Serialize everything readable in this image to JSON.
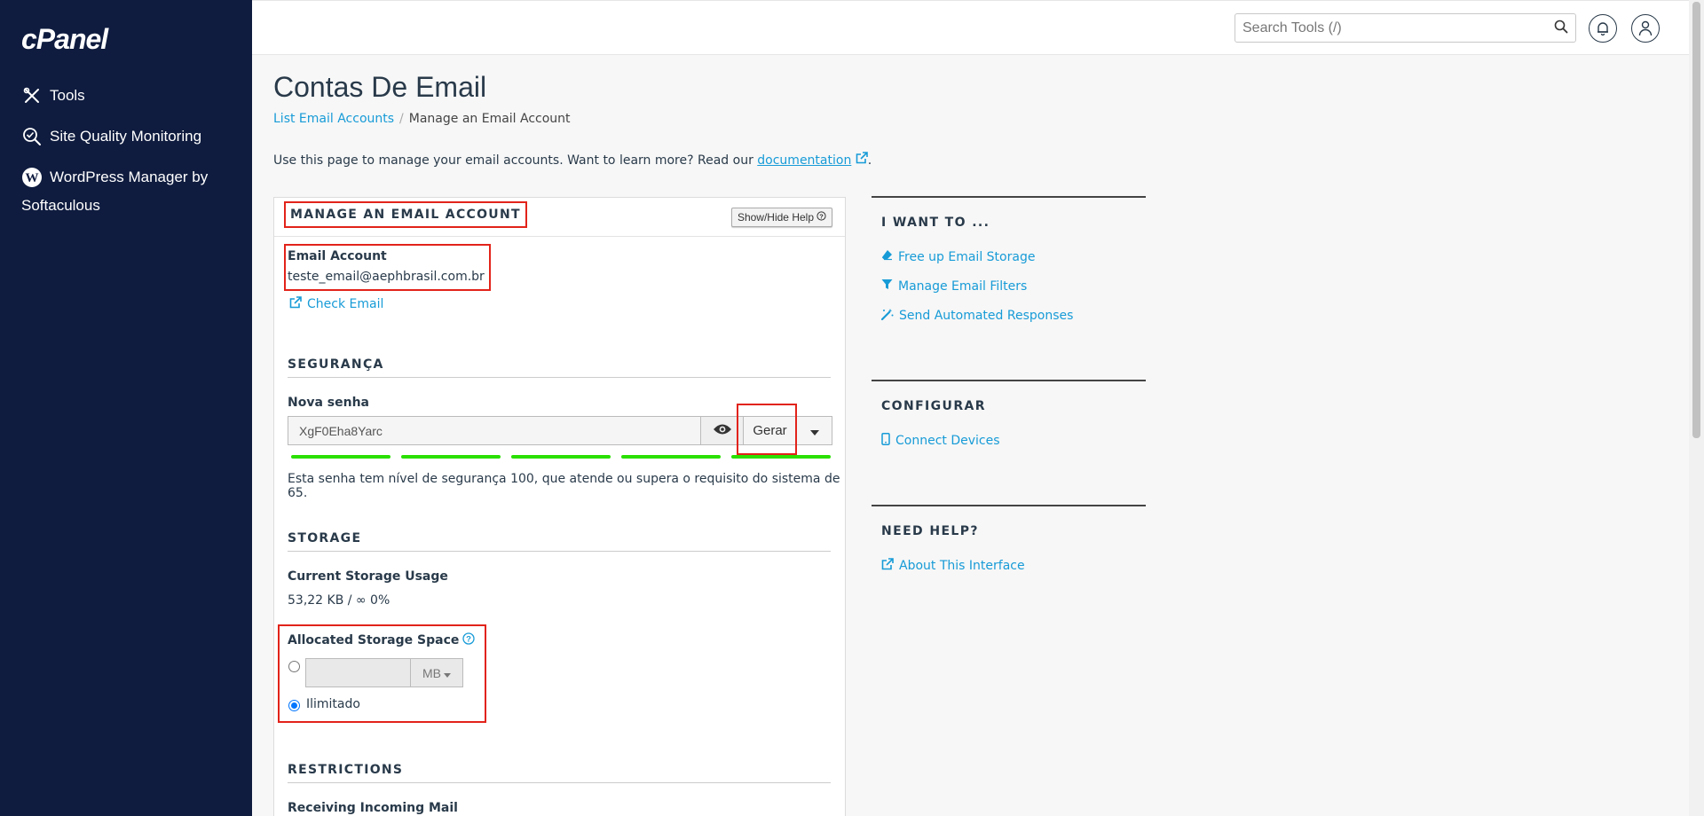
{
  "sidebar": {
    "logo": "cPanel",
    "items": [
      {
        "label": "Tools",
        "icon": "tools-icon"
      },
      {
        "label": "Site Quality Monitoring",
        "icon": "magnifier-check-icon"
      },
      {
        "label": "WordPress Manager by Softaculous",
        "icon": "wordpress-icon"
      }
    ]
  },
  "topbar": {
    "search_placeholder": "Search Tools (/)"
  },
  "page": {
    "title": "Contas De Email",
    "breadcrumb": [
      "List Email Accounts",
      "Manage an Email Account"
    ],
    "intro_text": "Use this page to manage your email accounts. Want to learn more? Read our ",
    "intro_link": "documentation",
    "intro_end": "."
  },
  "panel": {
    "title": "MANAGE AN EMAIL ACCOUNT",
    "help_button": "Show/Hide Help",
    "email_account_label": "Email Account",
    "email_account_value": "teste_email@aephbrasil.com.br",
    "check_email": "Check Email",
    "security_heading": "SEGURANÇA",
    "password_label": "Nova senha",
    "password_value": "XgF0Eha8Yarc",
    "generate_button": "Gerar",
    "strength_text": "Esta senha tem nível de segurança 100, que atende ou supera o requisito do sistema de 65.",
    "storage_heading": "STORAGE",
    "current_usage_label": "Current Storage Usage",
    "current_usage_value": "53,22 KB / ∞ 0%",
    "allocated_label": "Allocated Storage Space",
    "unit": "MB",
    "unlimited_label": "Ilimitado",
    "restrictions_heading": "RESTRICTIONS",
    "receiving_label": "Receiving Incoming Mail"
  },
  "side": {
    "want_heading": "I WANT TO ...",
    "want_links": [
      "Free up Email Storage",
      "Manage Email Filters",
      "Send Automated Responses"
    ],
    "configure_heading": "CONFIGURAR",
    "configure_links": [
      "Connect Devices"
    ],
    "help_heading": "NEED HELP?",
    "help_links": [
      "About This Interface"
    ]
  },
  "colors": {
    "sidebar_bg": "#0f1c3f",
    "link": "#179bd7",
    "highlight": "#e2231a",
    "strength": "#2ae000"
  }
}
